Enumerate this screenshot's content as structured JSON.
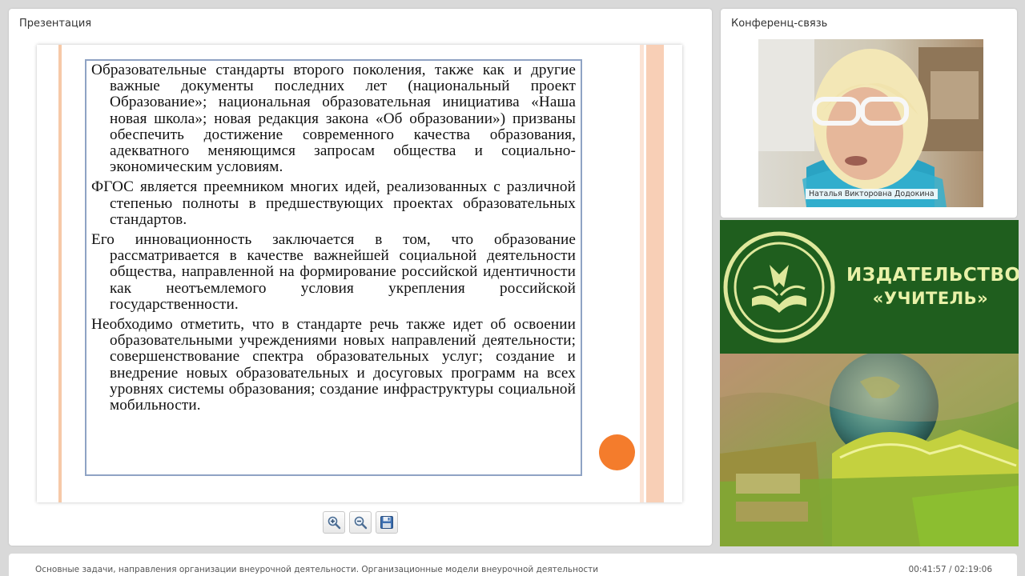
{
  "presentation": {
    "title": "Презентация",
    "slide": {
      "paragraphs": [
        "Образовательные стандарты второго поколения, также как и другие важные документы последних лет (национальный проект Образование»; национальная образовательная инициатива «Наша новая школа»; новая редакция закона «Об образовании») призваны обеспечить достижение современного качества образования, адекватного меняющимся запросам общества и социально-экономическим условиям.",
        "ФГОС является преемником многих идей, реализованных с различной степенью полноты в предшествующих проектах образовательных стандартов.",
        "Его инновационность заключается в том, что образование рассматривается в качестве важнейшей социальной деятельности общества, направленной на формирование российской идентичности как неотъемлемого условия укрепления российской государственности.",
        "Необходимо отметить, что в стандарте  речь также идет об освоении образовательными учреждениями новых направлений деятельности; совершенствование спектра образовательных услуг; создание и внедрение новых образовательных и досуговых программ на всех уровнях системы образования; создание инфраструктуры социальной мобильности."
      ]
    },
    "toolbar": {
      "zoom_in_icon": "zoom-in-icon",
      "zoom_out_icon": "zoom-out-icon",
      "save_icon": "save-icon"
    }
  },
  "conference": {
    "title": "Конференц-связь",
    "speaker_name": "Наталья Викторовна Додокина"
  },
  "publisher": {
    "line1": "ИЗДАТЕЛЬСТВО",
    "line2": "«УЧИТЕЛЬ»"
  },
  "footer": {
    "lecture_title": "Основные задачи, направления организации внеурочной деятельности. Организационные модели внеурочной деятельности",
    "time": "00:41:57 / 02:19:06"
  },
  "colors": {
    "page_bg": "#d9d9d9",
    "accent_orange": "#f47c2c",
    "banner_green": "#1f5e1e",
    "publisher_text": "#e9f1a8"
  }
}
